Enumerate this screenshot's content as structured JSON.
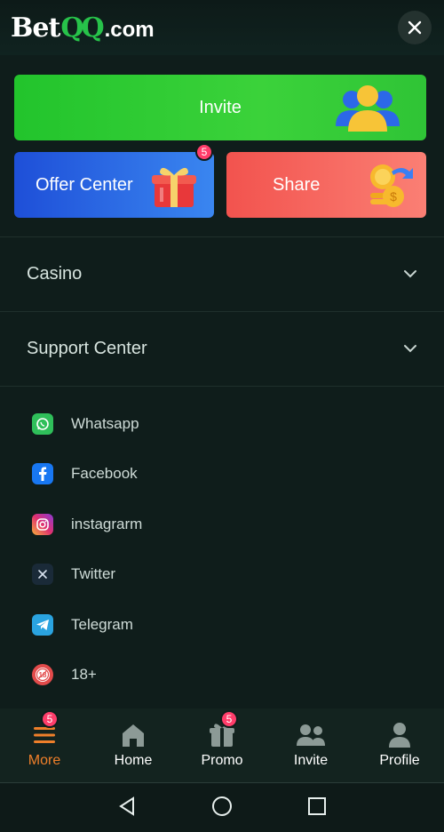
{
  "header": {
    "logo": {
      "bet": "Bet",
      "qq": "QQ",
      "com": ".com"
    },
    "close_icon": "close-icon"
  },
  "cards": {
    "invite": {
      "label": "Invite",
      "icon": "users-icon"
    },
    "offer": {
      "label": "Offer Center",
      "badge": "5",
      "icon": "gift-box-icon"
    },
    "share": {
      "label": "Share",
      "icon": "coins-share-icon"
    }
  },
  "accordions": [
    {
      "label": "Casino",
      "icon": "chevron-down-icon"
    },
    {
      "label": "Support Center",
      "icon": "chevron-down-icon"
    }
  ],
  "social": [
    {
      "label": "Whatsapp",
      "icon": "whatsapp-icon",
      "color": "#2fbf5a"
    },
    {
      "label": "Facebook",
      "icon": "facebook-icon",
      "color": "#1877f2"
    },
    {
      "label": "instagrarm",
      "icon": "instagram-icon",
      "color": "#d6317a"
    },
    {
      "label": "Twitter",
      "icon": "twitter-x-icon",
      "color": "#1a2a38"
    },
    {
      "label": "Telegram",
      "icon": "telegram-icon",
      "color": "#2aa3e0"
    },
    {
      "label": "18+",
      "icon": "age-18-icon",
      "color": "#e24b4b"
    }
  ],
  "bottom_nav": [
    {
      "label": "More",
      "icon": "menu-icon",
      "badge": "5",
      "active": true
    },
    {
      "label": "Home",
      "icon": "home-icon",
      "active": false
    },
    {
      "label": "Promo",
      "icon": "gift-icon",
      "badge": "5",
      "active": false
    },
    {
      "label": "Invite",
      "icon": "users-icon",
      "active": false
    },
    {
      "label": "Profile",
      "icon": "profile-icon",
      "active": false
    }
  ],
  "colors": {
    "background": "#0f1d1b",
    "invite_green": "#2fc436",
    "offer_blue": "#2563e0",
    "share_red": "#f56a62",
    "active_orange": "#ef7f2a",
    "badge_pink": "#ff3d6a"
  }
}
